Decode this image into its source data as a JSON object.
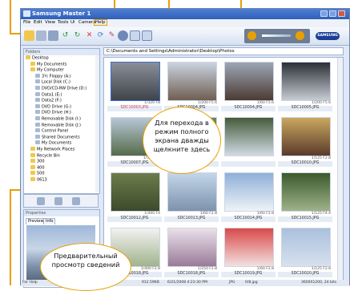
{
  "window": {
    "title": "Samsung Master 1"
  },
  "menu": [
    "File",
    "Edit",
    "View",
    "Tools",
    "Ui",
    "Camera",
    "Help"
  ],
  "toolbar_icons": [
    "open-icon",
    "import-icon",
    "print-icon",
    "rotate-left-icon",
    "rotate-right-icon",
    "delete-icon",
    "refresh-icon",
    "edit-icon",
    "slideshow-icon",
    "view-icon",
    "layout-icon"
  ],
  "brand": "SAMSUNG",
  "address": "C:\\Documents and Settings\\Administrator\\Desktop\\Photos",
  "folders_title": "Folders",
  "tree": [
    {
      "label": "Desktop",
      "indent": 0
    },
    {
      "label": "My Documents",
      "indent": 1
    },
    {
      "label": "My Computer",
      "indent": 1
    },
    {
      "label": "3½ Floppy (A:)",
      "indent": 2
    },
    {
      "label": "Local Disk (C:)",
      "indent": 2
    },
    {
      "label": "DVD/CD-RW Drive (D:)",
      "indent": 2
    },
    {
      "label": "Data1 (E:)",
      "indent": 2
    },
    {
      "label": "Data2 (F:)",
      "indent": 2
    },
    {
      "label": "DVD Drive (G:)",
      "indent": 2
    },
    {
      "label": "DVD Drive (H:)",
      "indent": 2
    },
    {
      "label": "Removable Disk (I:)",
      "indent": 2
    },
    {
      "label": "Removable Disk (J:)",
      "indent": 2
    },
    {
      "label": "Control Panel",
      "indent": 2
    },
    {
      "label": "Shared Documents",
      "indent": 2
    },
    {
      "label": "My Documents",
      "indent": 2
    },
    {
      "label": "My Network Places",
      "indent": 1
    },
    {
      "label": "Recycle Bin",
      "indent": 1
    },
    {
      "label": "300",
      "indent": 1
    },
    {
      "label": "400",
      "indent": 1
    },
    {
      "label": "500",
      "indent": 1
    },
    {
      "label": "0613",
      "indent": 1
    }
  ],
  "properties": {
    "title": "Properties",
    "tabs": [
      "Preview",
      "Info"
    ]
  },
  "thumbnails": [
    {
      "info": "1/320 F8",
      "name": "SDC10003.JPG",
      "selected": true
    },
    {
      "info": "1/200 F5.6",
      "name": "SDC10004.JPG",
      "selected": false
    },
    {
      "info": "1/60 F5.6",
      "name": "SDC10004.JPG",
      "selected": false
    },
    {
      "info": "1/200 F5.6",
      "name": "SDC10005.JPG",
      "selected": false
    },
    {
      "info": "1/50 F2.8",
      "name": "SDC10007.JPG",
      "selected": false
    },
    {
      "info": "",
      "name": "",
      "selected": false
    },
    {
      "info": "",
      "name": "",
      "selected": false
    },
    {
      "info": "1/125 F2.8",
      "name": "SDC10010.JPG",
      "selected": false
    },
    {
      "info": "1/400 F4",
      "name": "SDC10012.JPG",
      "selected": false
    },
    {
      "info": "1/60 F2.8",
      "name": "SDC10013.JPG",
      "selected": false
    },
    {
      "info": "1/60 F2.8",
      "name": "SDC10014.JPG",
      "selected": false
    },
    {
      "info": "1/125 F4.4",
      "name": "SDC10015.JPG",
      "selected": false
    },
    {
      "info": "1/400 F2.8",
      "name": "SDC10018.JPG",
      "selected": false
    },
    {
      "info": "1/250 F2.8",
      "name": "SDC10018.JPG",
      "selected": false
    },
    {
      "info": "1/60 F2.8",
      "name": "SDC10019.JPG",
      "selected": false
    },
    {
      "info": "1/125 F2.8",
      "name": "SDC10020.JPG",
      "selected": false
    }
  ],
  "status": {
    "help": "For Help",
    "size": "912.59KB",
    "date": "6/21/2008 4:23:30 PM",
    "type": "JPG",
    "file": "0/8.jpg",
    "dims": "3600X1200, 24 bits"
  },
  "balloon_center": "Для перехода в режим полного экрана дважды щелкните здесь",
  "balloon_bottom": "Предварительный просмотр сведений",
  "colors": {
    "accent": "#e8a000",
    "title_bar": "#2f5fb8",
    "selected_name": "#d04050"
  }
}
